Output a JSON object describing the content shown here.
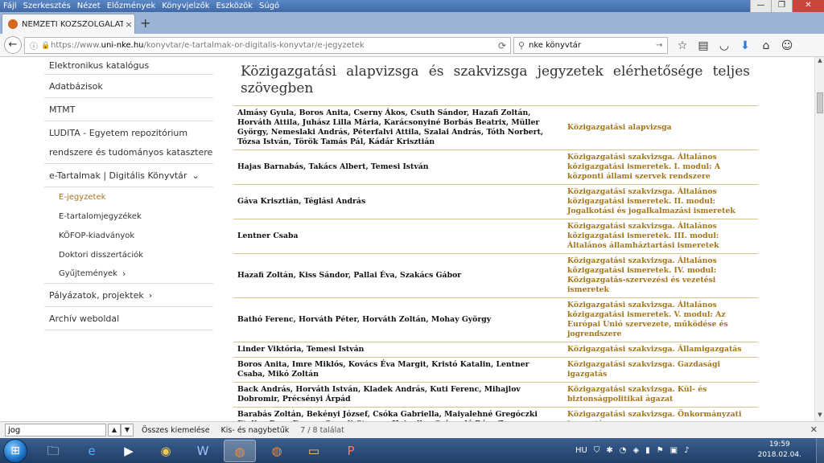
{
  "browser": {
    "menus": [
      "Fájl",
      "Szerkesztés",
      "Nézet",
      "Előzmények",
      "Könyvjelzők",
      "Eszközök",
      "Súgó"
    ],
    "window_controls": {
      "minimize": "—",
      "restore": "❐",
      "close": "✕"
    },
    "tab": {
      "title": "NEMZETI KÖZSZOLGÁLATI...",
      "close": "×"
    },
    "newtab": "+",
    "url_prefix": "https://www.",
    "url_domain": "uni-nke.hu",
    "url_path": "/konyvtar/e-tartalmak-or-digitalis-konyvtar/e-jegyzetek",
    "search_value": "nke könyvtár"
  },
  "sidebar": {
    "items": [
      {
        "label": "Elektronikus katalógus"
      },
      {
        "label": "Adatbázisok"
      },
      {
        "label": "MTMT"
      },
      {
        "label": "LUDITA - Egyetem repozitórium rendszere és tudományos katasztere"
      },
      {
        "label": "e-Tartalmak | Digitális Könyvtár"
      }
    ],
    "subitems": [
      {
        "label": "E-jegyzetek"
      },
      {
        "label": "E-tartalomjegyzékek"
      },
      {
        "label": "KÖFOP-kiadványok"
      },
      {
        "label": "Doktori disszertációk"
      },
      {
        "label": "Gyűjtemények"
      }
    ],
    "bottom_items": [
      {
        "label": "Pályázatok, projektek"
      },
      {
        "label": "Archív weboldal"
      }
    ]
  },
  "main": {
    "heading": "Közigazgatási alapvizsga és szakvizsga jegyzetek elérhetősége teljes szövegben",
    "rows": [
      {
        "authors": "Almásy Gyula, Boros Anita, Cserny Ákos, Csuth Sándor, Hazafi Zoltán, Horváth Attila, Juhász Lilla Mária, Karácsonyiné Borbás Beatrix, Müller György, Nemeslaki András, Péterfalvi Attila, Szalai András, Tóth Norbert, Tózsa István, Török Tamás Pál, Kádár Krisztián",
        "title": "Közigazgatási alapvizsga"
      },
      {
        "authors": "Hajas Barnabás, Takács Albert, Temesi István",
        "title": "Közigazgatási szakvizsga. Általános közigazgatási ismeretek. I. modul: A központi állami szervek rendszere"
      },
      {
        "authors": "Gáva Krisztián, Téglási András",
        "title": "Közigazgatási szakvizsga. Általános közigazgatási ismeretek. II. modul: Jogalkotási és jogalkalmazási ismeretek"
      },
      {
        "authors": "Lentner Csaba",
        "title": "Közigazgatási szakvizsga. Általános közigazgatási ismeretek. III. modul: Általános államháztartási ismeretek"
      },
      {
        "authors": "Hazafi Zoltán, Kiss Sándor, Pallai Éva, Szakács Gábor",
        "title": "Közigazgatási szakvizsga. Általános közigazgatási ismeretek. IV. modul: Közigazgatás-szervezési és vezetési ismeretek"
      },
      {
        "authors": "Bathó Ferenc, Horváth Péter, Horváth Zoltán, Mohay György",
        "title": "Közigazgatási szakvizsga. Általános közigazgatási ismeretek. V. modul: Az Európai Unió szervezete, működése és jogrendszere"
      },
      {
        "authors": "Linder Viktória, Temesi István",
        "title": "Közigazgatási szakvizsga. Államigazgatás"
      },
      {
        "authors": "Boros Anita, Imre Miklós, Kovács Éva Margit, Kristó Katalin, Lentner Csaba, Mikó Zoltán",
        "title": "Közigazgatási szakvizsga. Gazdasági igazgatás"
      },
      {
        "authors": "Back András, Horváth István, Kladek András, Kuti Ferenc, Mihajlov Dobromir, Précsényi Árpád",
        "title": "Közigazgatási szakvizsga. Kül- és biztonságpolitikai ágazat"
      },
      {
        "authors": "Barabás Zoltán, Bekényi József, Csóka Gabriella, Maiyalehné Gregóczki Etelka, Papp Emese, Szendi-Stenger Hajnalka, Számadó Róza Zsuzsanna",
        "title": "Közigazgatási szakvizsga. Önkormányzati igazgatás"
      }
    ]
  },
  "findbar": {
    "value": "jog",
    "highlight_all": "Összes kiemelése",
    "match_case": "Kis- és nagybetűk",
    "count": "7 / 8 találat"
  },
  "taskbar": {
    "language": "HU",
    "time": "19:59",
    "date": "2018.02.04."
  },
  "colors": {
    "link": "#a5751b",
    "border": "#d6c48f"
  }
}
